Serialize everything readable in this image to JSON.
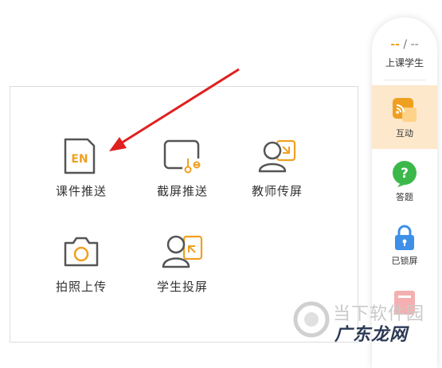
{
  "panel": {
    "tools": [
      {
        "label": "课件推送",
        "icon": "courseware-en-icon"
      },
      {
        "label": "截屏推送",
        "icon": "screenshot-scissors-icon"
      },
      {
        "label": "教师传屏",
        "icon": "teacher-screen-share-icon"
      },
      {
        "label": "拍照上传",
        "icon": "camera-icon"
      },
      {
        "label": "学生投屏",
        "icon": "student-screen-cast-icon"
      }
    ],
    "en_badge": "EN"
  },
  "sidebar": {
    "count_current": "--",
    "count_separator": " / ",
    "count_total": "--",
    "count_label": "上课学生",
    "items": [
      {
        "label": "互动",
        "icon": "interact-icon",
        "active": true
      },
      {
        "label": "答题",
        "icon": "answer-question-icon",
        "active": false
      },
      {
        "label": "已锁屏",
        "icon": "lock-icon",
        "active": false
      },
      {
        "label": "",
        "icon": "partial-red-icon",
        "active": false
      }
    ]
  },
  "watermark": {
    "line1": "当下软件园",
    "line2": "广东龙网"
  },
  "colors": {
    "accent_orange": "#f0a020",
    "icon_gray": "#555555",
    "active_bg": "#fde8cc",
    "arrow_red": "#e02020",
    "question_green": "#3cb84a",
    "lock_blue": "#3d8fe8"
  }
}
